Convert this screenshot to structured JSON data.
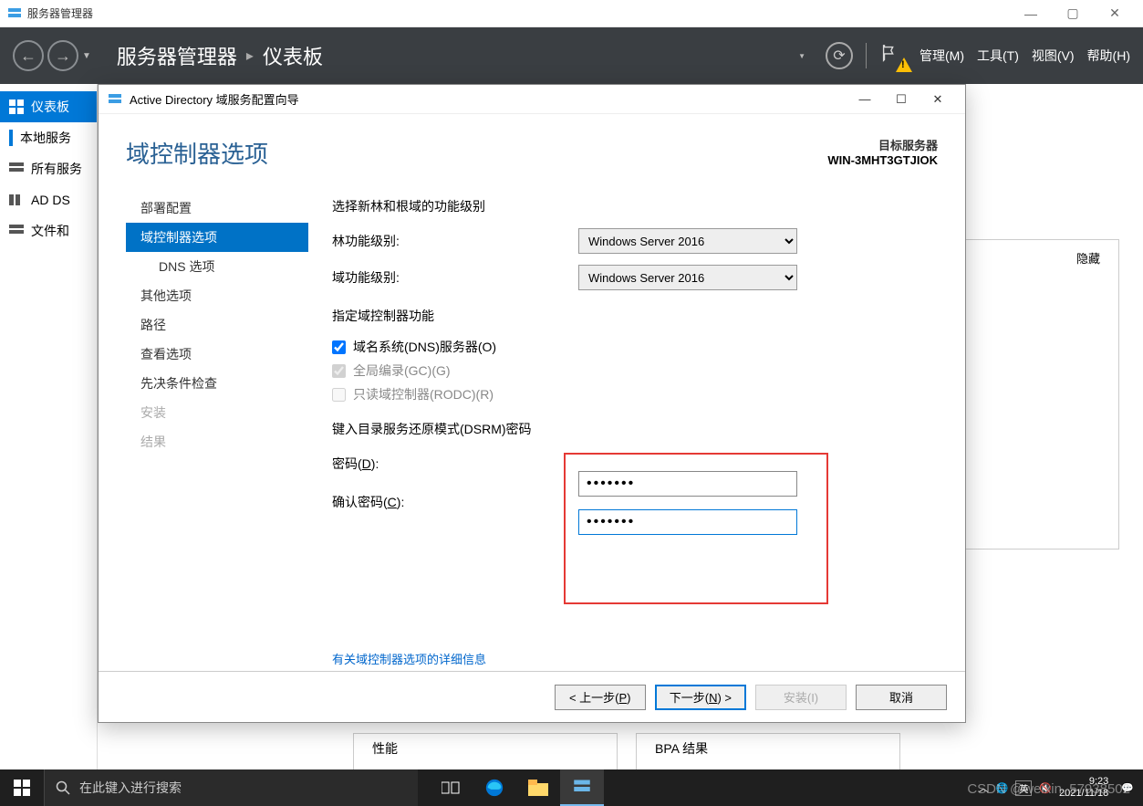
{
  "outerWindow": {
    "title": "服务器管理器",
    "controls": {
      "min": "—",
      "max": "▢",
      "close": "✕"
    }
  },
  "darkToolbar": {
    "breadcrumb": {
      "app": "服务器管理器",
      "page": "仪表板"
    },
    "menus": {
      "manage": "管理(M)",
      "tools": "工具(T)",
      "view": "视图(V)",
      "help": "帮助(H)"
    }
  },
  "leftNav": {
    "items": [
      "仪表板",
      "本地服务",
      "所有服务",
      "AD DS",
      "文件和"
    ]
  },
  "contentBehind": {
    "hide": "隐藏",
    "panelA": "性能",
    "panelB": "BPA 结果"
  },
  "wizard": {
    "title": "Active Directory 域服务配置向导",
    "controls": {
      "min": "—",
      "max": "☐",
      "close": "✕"
    },
    "heading": "域控制器选项",
    "target": {
      "label": "目标服务器",
      "name": "WIN-3MHT3GTJIOK"
    },
    "steps": {
      "deploy": "部署配置",
      "dcOptions": "域控制器选项",
      "dnsOptions": "DNS 选项",
      "other": "其他选项",
      "path": "路径",
      "review": "查看选项",
      "prereq": "先决条件检查",
      "install": "安装",
      "result": "结果"
    },
    "content": {
      "sectionFunc": "选择新林和根域的功能级别",
      "forestLabel": "林功能级别:",
      "domainLabel": "域功能级别:",
      "forestValue": "Windows Server 2016",
      "domainValue": "Windows Server 2016",
      "sectionCap": "指定域控制器功能",
      "cbDns": "域名系统(DNS)服务器(O)",
      "cbGc": "全局编录(GC)(G)",
      "cbRodc": "只读域控制器(RODC)(R)",
      "sectionDsrm": "键入目录服务还原模式(DSRM)密码",
      "pwLabel": "密码(D):",
      "pwConfirmLabel": "确认密码(C):",
      "pwValue": "●●●●●●●",
      "moreLink": "有关域控制器选项的详细信息"
    },
    "footer": {
      "prev": "< 上一步(P)",
      "next": "下一步(N) >",
      "install": "安装(I)",
      "cancel": "取消"
    }
  },
  "taskbar": {
    "searchPlaceholder": "在此键入进行搜索",
    "time": "9:23",
    "date": "2021/11/18",
    "watermark": "CSDN @weixin_57938502"
  }
}
